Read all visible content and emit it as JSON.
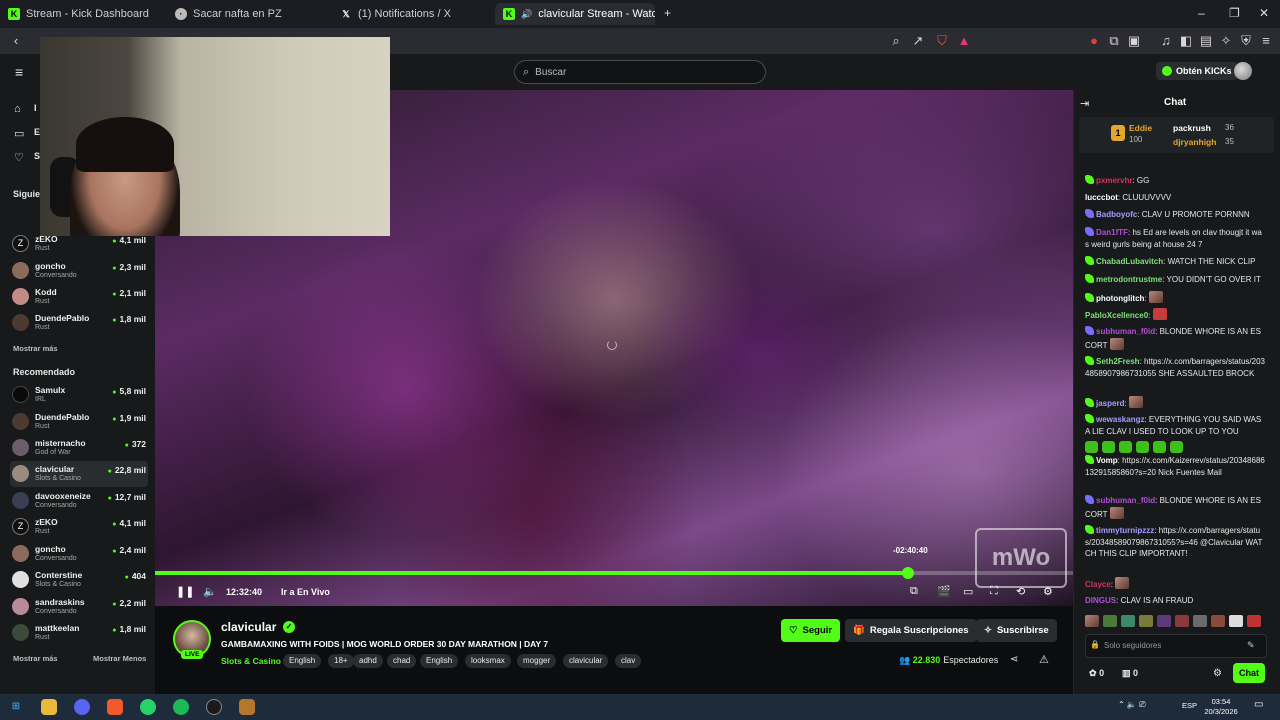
{
  "browser": {
    "tabs": [
      {
        "title": "Stream - Kick Dashboard",
        "icon": "kick-icon"
      },
      {
        "title": "Sacar nafta en PZ",
        "icon": "page-icon"
      },
      {
        "title": "(1) Notifications / X",
        "icon": "x-icon"
      },
      {
        "title": "clavicular Stream - Watch Liv",
        "icon": "kick-icon",
        "active": true
      }
    ]
  },
  "header": {
    "search_placeholder": "Buscar",
    "kicks_label": "Obtén KICKs"
  },
  "sidebar": {
    "nav_partial": [
      "I",
      "E",
      "S"
    ],
    "following_title": "Siguie",
    "following": [
      {
        "name": "zEKO",
        "category": "Rust",
        "viewers": "4,1 mil"
      },
      {
        "name": "goncho",
        "category": "Conversando",
        "viewers": "2,3 mil"
      },
      {
        "name": "Kodd",
        "category": "Rust",
        "viewers": "2,1 mil"
      },
      {
        "name": "DuendePablo",
        "category": "Rust",
        "viewers": "1,8 mil"
      }
    ],
    "show_more": "Mostrar más",
    "recommended_title": "Recomendado",
    "recommended": [
      {
        "name": "Samulx",
        "category": "IRL",
        "viewers": "5,8 mil"
      },
      {
        "name": "DuendePablo",
        "category": "Rust",
        "viewers": "1,9 mil"
      },
      {
        "name": "misternacho",
        "category": "God of War",
        "viewers": "372"
      },
      {
        "name": "clavicular",
        "category": "Slots & Casino",
        "viewers": "22,8 mil"
      },
      {
        "name": "davooxeneize",
        "category": "Conversando",
        "viewers": "12,7 mil"
      },
      {
        "name": "zEKO",
        "category": "Rust",
        "viewers": "4,1 mil"
      },
      {
        "name": "goncho",
        "category": "Conversando",
        "viewers": "2,4 mil"
      },
      {
        "name": "Conterstine",
        "category": "Slots & Casino",
        "viewers": "404"
      },
      {
        "name": "sandraskins",
        "category": "Conversando",
        "viewers": "2,2 mil"
      },
      {
        "name": "mattkeelan",
        "category": "Rust",
        "viewers": "1,8 mil"
      }
    ],
    "show_more_2": "Mostrar más",
    "show_less": "Mostrar Menos"
  },
  "player": {
    "elapsed": "12:32:40",
    "go_live": "Ir a En Vivo",
    "remaining": "-02:40:40",
    "progress": 0.82
  },
  "stream": {
    "streamer": "clavicular",
    "live_badge": "LIVE",
    "title": "GAMBAMAXING WITH FOIDS | MOG WORLD ORDER 30 DAY MARATHON | DAY 7",
    "category": "Slots & Casino",
    "tags": [
      "English",
      "18+",
      "adhd",
      "chad",
      "English",
      "looksmax",
      "mogger",
      "clavicular",
      "clav"
    ],
    "follow": "Seguir",
    "gift_subs": "Regala Suscripciones",
    "subscribe": "Suscribirse",
    "viewers": "22.830",
    "viewers_label": "Espectadores"
  },
  "chat": {
    "title": "Chat",
    "leaderboard": [
      {
        "rank": "1",
        "name": "Eddie",
        "value": "100"
      },
      {
        "name": "packrush",
        "value": "36"
      },
      {
        "name": "djryanhigh",
        "value": "35"
      }
    ],
    "messages": [
      {
        "user": "pxmervhr",
        "text": "GG"
      },
      {
        "user": "lucccbot",
        "text": "CLUUUVVVV"
      },
      {
        "user": "Badboyofc",
        "text": "CLAV U PROMOTE PORNNN"
      },
      {
        "user": "Dan1fTF",
        "text": "hs Ed are levels on clav thougjt it was weird gurls being at house 24 7"
      },
      {
        "user": "ChabadLubavitch",
        "text": "WATCH THE NICK CLIP"
      },
      {
        "user": "metrodontrustme",
        "text": "YOU DIDN'T GO OVER IT"
      },
      {
        "user": "photonglitch",
        "text": ""
      },
      {
        "user": "PabloXcellence0",
        "text": ""
      },
      {
        "user": "subhuman_f0id",
        "text": "BLONDE WHORE IS AN ESCORT"
      },
      {
        "user": "Seth2Fresh",
        "text": "https://x.com/barragers/status/2034858907986731055 SHE ASSAULTED BROCK"
      },
      {
        "user": "jasperd",
        "text": ""
      },
      {
        "user": "wewaskangz",
        "text": "EVERYTHING YOU SAID WAS A LIE CLAV  I USED TO LOOK UP TO YOU"
      },
      {
        "user": "Vomp",
        "text": "https://x.com/Kaizerrev/status/2034868613291585860?s=20 Nick Fuentes Mail"
      },
      {
        "user": "subhuman_f0id",
        "text": "BLONDE WHORE IS AN ESCORT"
      },
      {
        "user": "timmyturnipzzz",
        "text": "https://x.com/barragers/status/2034858907986731055?s=46 @Clavicular WATCH THIS CLIP IMPORTANT!"
      },
      {
        "user": "Clayce",
        "text": ""
      },
      {
        "user": "DINGUS",
        "text": "CLAV IS AN FRAUD"
      }
    ],
    "input_placeholder": "Solo seguidores",
    "send_label": "Chat",
    "kicks_count": "0",
    "gift_count": "0"
  },
  "taskbar": {
    "lang": "ESP",
    "time": "03:54",
    "date": "20/3/2026"
  },
  "colors": {
    "kick_green": "#53fc18",
    "panel": "#17191b",
    "background": "#0b0d0e"
  }
}
